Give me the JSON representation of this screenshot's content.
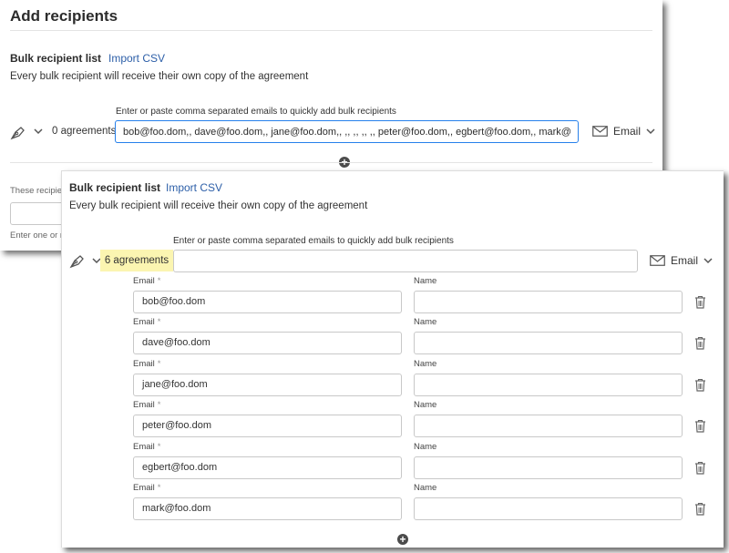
{
  "back": {
    "title": "Add recipients",
    "section_title": "Bulk recipient list",
    "import_label": "Import CSV",
    "description": "Every bulk recipient will receive their own copy of the agreement",
    "hint": "Enter or paste comma separated emails to quickly add bulk recipients",
    "agreements": "0 agreements",
    "input_value": "bob@foo.dom,, dave@foo.dom,, jane@foo.dom,, ,, ,, ,, ,, peter@foo.dom,, egbert@foo.dom,, mark@foo.dom",
    "email_label": "Email",
    "partial_text_1": "These recipien",
    "partial_text_2": "Enter one or m"
  },
  "front": {
    "section_title": "Bulk recipient list",
    "import_label": "Import CSV",
    "description": "Every bulk recipient will receive their own copy of the agreement",
    "hint": "Enter or paste comma separated emails to quickly add bulk recipients",
    "agreements": "6 agreements",
    "input_value": "",
    "email_label": "Email",
    "email_field_label": "Email",
    "required_mark": "*",
    "name_field_label": "Name",
    "recipients": [
      {
        "email": "bob@foo.dom",
        "name": ""
      },
      {
        "email": "dave@foo.dom",
        "name": ""
      },
      {
        "email": "jane@foo.dom",
        "name": ""
      },
      {
        "email": "peter@foo.dom",
        "name": ""
      },
      {
        "email": "egbert@foo.dom",
        "name": ""
      },
      {
        "email": "mark@foo.dom",
        "name": ""
      }
    ]
  },
  "colors": {
    "link": "#2d5fa8",
    "highlight": "#fbf5b1",
    "focus_border": "#2680eb"
  },
  "icons": {
    "signer": "pen-nib-icon",
    "dropdown": "chevron-down-icon",
    "email": "envelope-icon",
    "add": "plus-circle-icon",
    "delete": "trash-icon"
  }
}
